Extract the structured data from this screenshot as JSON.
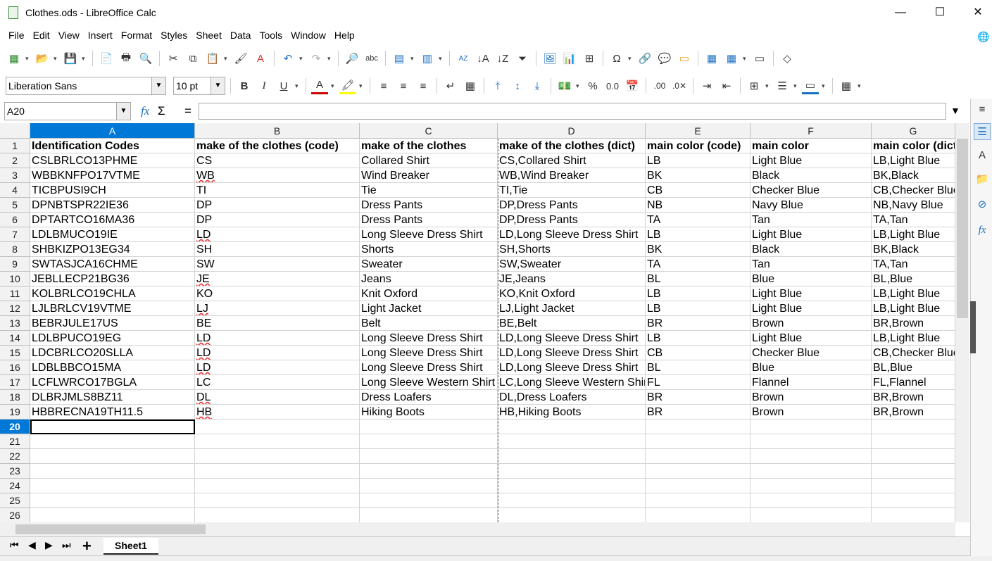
{
  "window": {
    "title": "Clothes.ods - LibreOffice Calc",
    "minimize": "—",
    "maximize": "☐",
    "close": "✕"
  },
  "menu": [
    "File",
    "Edit",
    "View",
    "Insert",
    "Format",
    "Styles",
    "Sheet",
    "Data",
    "Tools",
    "Window",
    "Help"
  ],
  "format_toolbar": {
    "font_name": "Liberation Sans",
    "font_size": "10 pt"
  },
  "formula_bar": {
    "name_box": "A20",
    "fx": "fx",
    "sum": "Σ",
    "equals": "=",
    "content": ""
  },
  "columns": [
    "A",
    "B",
    "C",
    "D",
    "E",
    "F",
    "G"
  ],
  "selected_cell": "A20",
  "rows": [
    [
      "Identification Codes",
      "make of the clothes (code)",
      "make of the clothes",
      "make of the clothes (dict)",
      "main color (code)",
      "main color",
      "main color (dict)"
    ],
    [
      "CSLBRLCO13PHME",
      "CS",
      "Collared Shirt",
      "CS,Collared Shirt",
      "LB",
      "Light Blue",
      "LB,Light Blue"
    ],
    [
      "WBBKNFPO17VTME",
      "WB",
      "Wind Breaker",
      "WB,Wind Breaker",
      "BK",
      "Black",
      "BK,Black"
    ],
    [
      "TICBPUSI9CH",
      "TI",
      "Tie",
      "TI,Tie",
      "CB",
      "Checker Blue",
      "CB,Checker Blue"
    ],
    [
      "DPNBTSPR22IE36",
      "DP",
      "Dress Pants",
      "DP,Dress Pants",
      "NB",
      "Navy Blue",
      "NB,Navy Blue"
    ],
    [
      "DPTARTCO16MA36",
      "DP",
      "Dress Pants",
      "DP,Dress Pants",
      "TA",
      "Tan",
      "TA,Tan"
    ],
    [
      "LDLBMUCO19IE",
      "LD",
      "Long Sleeve Dress Shirt",
      "LD,Long Sleeve Dress Shirt",
      "LB",
      "Light Blue",
      "LB,Light Blue"
    ],
    [
      "SHBKIZPO13EG34",
      "SH",
      "Shorts",
      "SH,Shorts",
      "BK",
      "Black",
      "BK,Black"
    ],
    [
      "SWTASJCA16CHME",
      "SW",
      "Sweater",
      "SW,Sweater",
      "TA",
      "Tan",
      "TA,Tan"
    ],
    [
      "JEBLLECP21BG36",
      "JE",
      "Jeans",
      "JE,Jeans",
      "BL",
      "Blue",
      "BL,Blue"
    ],
    [
      "KOLBRLCO19CHLA",
      "KO",
      "Knit Oxford",
      "KO,Knit Oxford",
      "LB",
      "Light Blue",
      "LB,Light Blue"
    ],
    [
      "LJLBRLCV19VTME",
      "LJ",
      "Light Jacket",
      "LJ,Light Jacket",
      "LB",
      "Light Blue",
      "LB,Light Blue"
    ],
    [
      "BEBRJULE17US",
      "BE",
      "Belt",
      "BE,Belt",
      "BR",
      "Brown",
      "BR,Brown"
    ],
    [
      "LDLBPUCO19EG",
      "LD",
      "Long Sleeve Dress Shirt",
      "LD,Long Sleeve Dress Shirt",
      "LB",
      "Light Blue",
      "LB,Light Blue"
    ],
    [
      "LDCBRLCO20SLLA",
      "LD",
      "Long Sleeve Dress Shirt",
      "LD,Long Sleeve Dress Shirt",
      "CB",
      "Checker Blue",
      "CB,Checker Blue"
    ],
    [
      "LDBLBBCO15MA",
      "LD",
      "Long Sleeve Dress Shirt",
      "LD,Long Sleeve Dress Shirt",
      "BL",
      "Blue",
      "BL,Blue"
    ],
    [
      "LCFLWRCO17BGLA",
      "LC",
      "Long Sleeve Western Shirt",
      "LC,Long Sleeve Western Shirt",
      "FL",
      "Flannel",
      "FL,Flannel"
    ],
    [
      "DLBRJMLS8BZ11",
      "DL",
      "Dress Loafers",
      "DL,Dress Loafers",
      "BR",
      "Brown",
      "BR,Brown"
    ],
    [
      "HBBRECNA19TH11.5",
      "HB",
      "Hiking Boots",
      "HB,Hiking Boots",
      "BR",
      "Brown",
      "BR,Brown"
    ]
  ],
  "squiggly_codes": [
    "WB",
    "LD",
    "JE",
    "LJ",
    "DL",
    "HB"
  ],
  "row_numbers": [
    "1",
    "2",
    "3",
    "4",
    "5",
    "6",
    "7",
    "8",
    "9",
    "10",
    "11",
    "12",
    "13",
    "14",
    "15",
    "16",
    "17",
    "18",
    "19",
    "20",
    "21",
    "22",
    "23",
    "24",
    "25",
    "26"
  ],
  "sheet_tabs": {
    "active": "Sheet1",
    "add": "+"
  }
}
